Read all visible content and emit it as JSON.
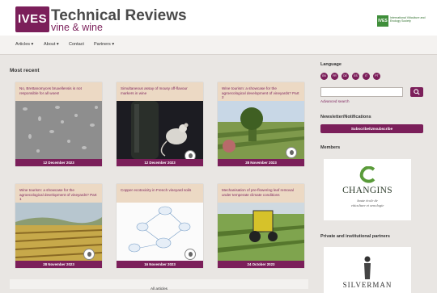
{
  "header": {
    "logo_text": "IVES",
    "title": "Technical Reviews",
    "subtitle": "vine & wine",
    "partner_logo_text": "International Viticulture and Enology Society"
  },
  "nav": [
    {
      "label": "Articles ▾"
    },
    {
      "label": "About ▾"
    },
    {
      "label": "Contact"
    },
    {
      "label": "Partners ▾"
    }
  ],
  "main": {
    "section_title": "Most recent",
    "cards": [
      {
        "title": "No, Brettanomyces bruxellensis is not responsible for all woes!",
        "date": "12 December 2023"
      },
      {
        "title": "Simultaneous assay of mousy off-flavour markers in wine",
        "date": "12 December 2023"
      },
      {
        "title": "Wine tourism: a showcase for the agroecological development of vineyards? Part 2",
        "date": "28 November 2023"
      },
      {
        "title": "Wine tourism: a showcase for the agroecological development of vineyards? Part 1",
        "date": "28 November 2023"
      },
      {
        "title": "Copper ecotoxicity in French vineyard soils",
        "date": "16 November 2023"
      },
      {
        "title": "Mechanisation of pre-flowering leaf removal under temperate climate conditions",
        "date": "24 October 2023"
      }
    ],
    "all_articles": "All articles"
  },
  "aside": {
    "language_heading": "Language",
    "languages": [
      "EN",
      "FR",
      "DE",
      "ES",
      "IT",
      "PT"
    ],
    "search": {
      "placeholder": "",
      "button_icon": "search-icon"
    },
    "advanced_search": "Advanced search",
    "newsletter_heading": "Newsletter/Notifications",
    "subscribe_label": "Subscribe/Unsubscribe",
    "members_heading": "Members",
    "member_logo": {
      "name": "CHANGINS",
      "tagline_1": "haute école de",
      "tagline_2": "viticulture et oenologie"
    },
    "partners_heading": "Private and institutional partners",
    "partner_logo": {
      "name": "SILVERMAN"
    }
  },
  "colors": {
    "brand": "#7b1f5a",
    "card_title_bg": "#ecd9c4",
    "page_bg": "#e9e6e3"
  }
}
